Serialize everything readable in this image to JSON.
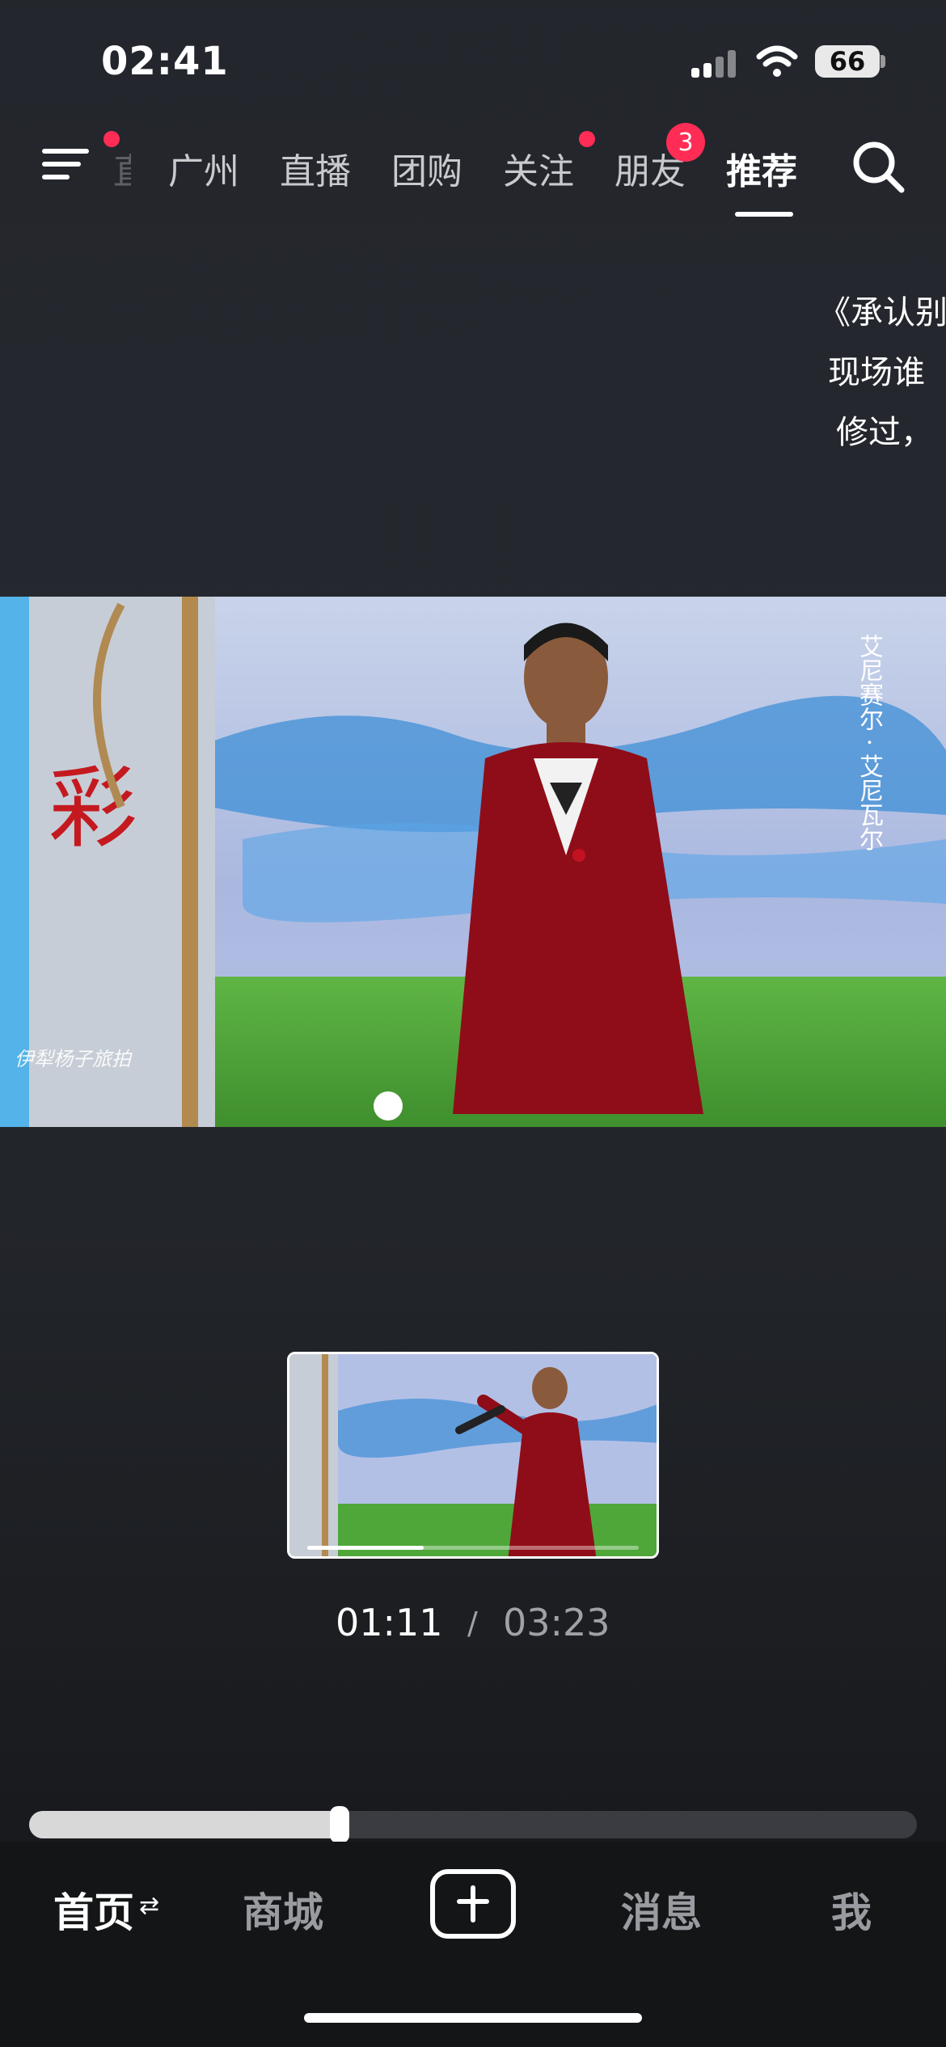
{
  "status_bar": {
    "time": "02:41",
    "battery": "66"
  },
  "top_nav": {
    "partial_tab": "直",
    "tabs": [
      {
        "label": "广州"
      },
      {
        "label": "直播"
      },
      {
        "label": "团购"
      },
      {
        "label": "关注"
      },
      {
        "label": "朋友",
        "badge": "3"
      },
      {
        "label": "推荐",
        "active": true
      }
    ]
  },
  "side_caption": {
    "lines": [
      "《承认别",
      "现场谁",
      "修过，"
    ]
  },
  "video": {
    "overlay_text_vertical": "艾尼赛尔 · 艾尼瓦尔",
    "watermark": "伊犁杨子旅拍"
  },
  "scrub_preview": {
    "current_time": "01:11",
    "separator": "/",
    "total_time": "03:23",
    "progress_fraction": 0.35
  },
  "playback_progress_fraction": 0.35,
  "tab_bar": {
    "home": "首页",
    "home_switch_glyph": "⇄",
    "mall": "商城",
    "messages": "消息",
    "me": "我"
  }
}
